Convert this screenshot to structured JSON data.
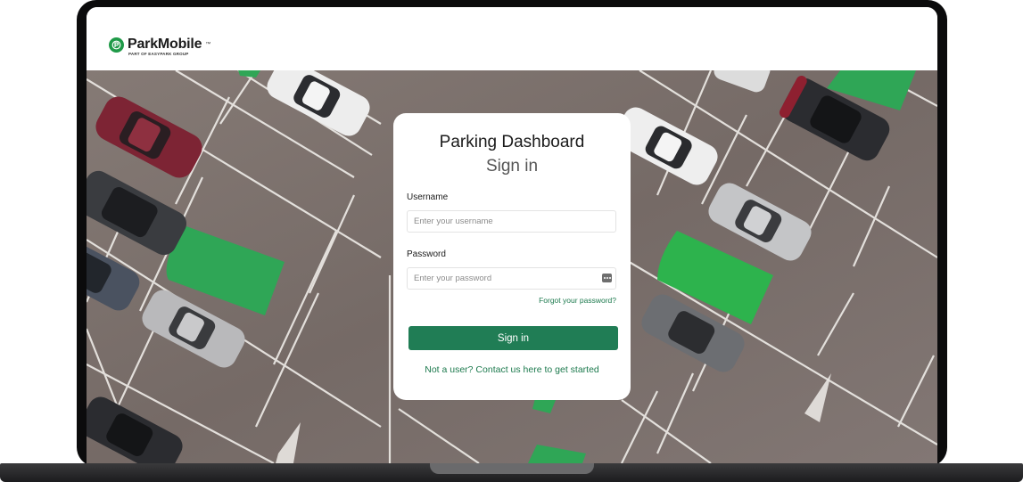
{
  "brand": {
    "name": "ParkMobile",
    "trademark": "™",
    "subtitle": "PART OF EASYPARK GROUP",
    "logo_color": "#1f9a48"
  },
  "login": {
    "title": "Parking Dashboard",
    "subtitle": "Sign in",
    "username_label": "Username",
    "username_placeholder": "Enter your username",
    "username_value": "",
    "password_label": "Password",
    "password_placeholder": "Enter your password",
    "password_value": "",
    "password_reveal_icon": "password-manager-icon",
    "forgot_link": "Forgot your password?",
    "signin_button": "Sign in",
    "contact_link": "Not a user? Contact us here to get started",
    "accent_color": "#207d55"
  },
  "background": {
    "description_icon": "parking-lot-image"
  }
}
